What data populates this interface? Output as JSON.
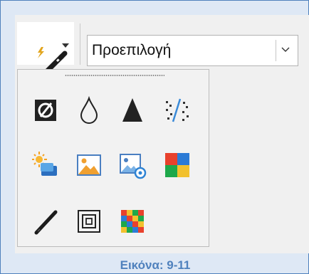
{
  "toolbar": {
    "filter_button_icon": "magic-wand-icon",
    "dropdown_icon": "caret-down-icon"
  },
  "preset_combo": {
    "value": "Προεπιλογή",
    "arrow_icon": "chevron-down-icon"
  },
  "filter_popup": {
    "grip_icon": "drag-grip-icon",
    "rows": [
      [
        "invert-icon",
        "smooth-drop-icon",
        "sharpen-triangle-icon",
        "remove-noise-icon"
      ],
      [
        "solarization-icon",
        "aging-icon",
        "posterize-icon",
        "pop-art-icon"
      ],
      [
        "charcoal-sketch-icon",
        "relief-icon",
        "mosaic-icon"
      ]
    ]
  },
  "caption": "Εικόνα: 9-11",
  "colors": {
    "frame_border": "#4f81bd",
    "frame_fill": "#dee8f5",
    "caption": "#4f81bd",
    "popart": [
      "#e8412c",
      "#2b7bd6",
      "#1ea84a",
      "#f2c12e"
    ]
  }
}
